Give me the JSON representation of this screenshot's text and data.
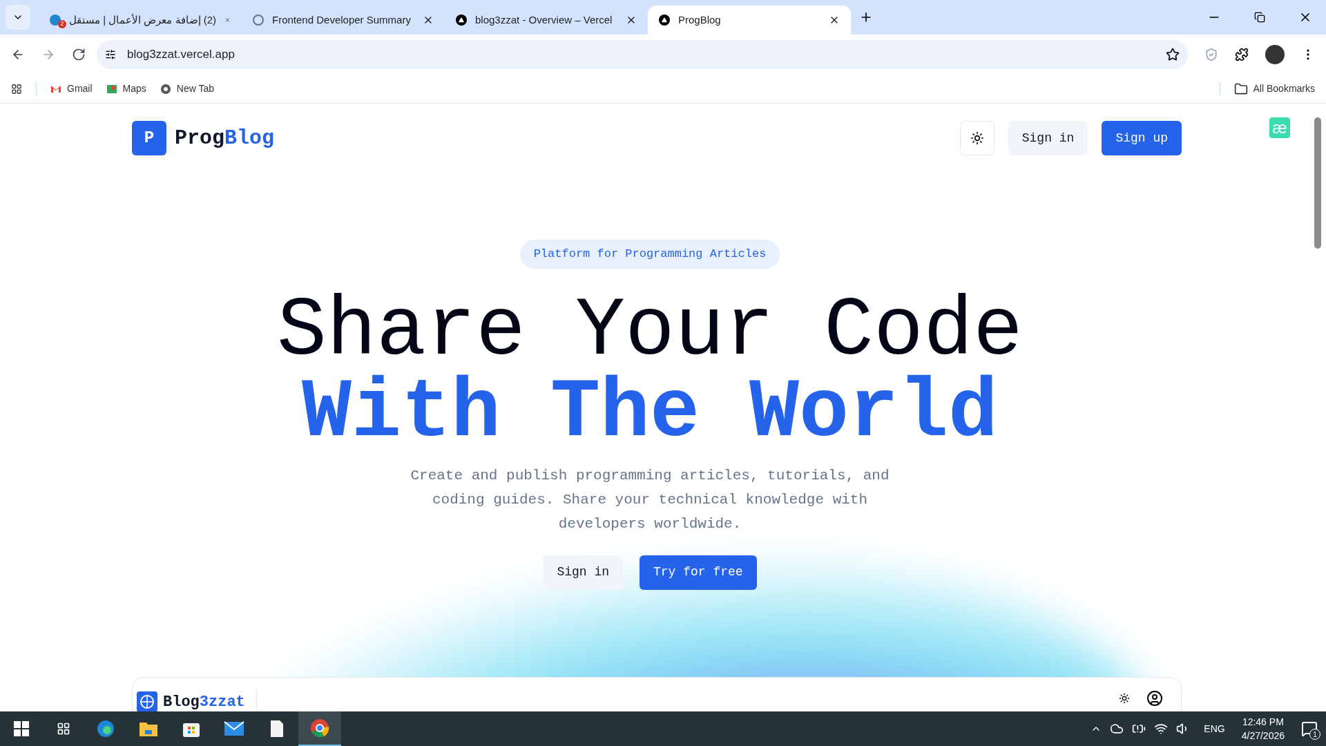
{
  "browser": {
    "tabs": [
      {
        "title": "(2) إضافة معرض الأعمال | مستقل",
        "badge": "2",
        "selected": false
      },
      {
        "title": "Frontend Developer Summary",
        "selected": false
      },
      {
        "title": "blog3zzat - Overview – Vercel",
        "selected": false
      },
      {
        "title": "ProgBlog",
        "selected": true
      }
    ],
    "url": "blog3zzat.vercel.app",
    "bookmarks": [
      {
        "label": "Gmail"
      },
      {
        "label": "Maps"
      },
      {
        "label": "New Tab"
      }
    ],
    "all_bookmarks": "All Bookmarks"
  },
  "page": {
    "logo": {
      "letter": "P",
      "name_part1": "Prog",
      "name_part2": "Blog"
    },
    "nav_buttons": [
      {
        "label": "Sign in",
        "kind": "secondary"
      },
      {
        "label": "Sign up",
        "kind": "primary"
      }
    ],
    "extension_badge": "æ",
    "badge": "Platform for Programming Articles",
    "headline_line1": "Share Your Code",
    "headline_line2": "With The World",
    "description": "Create and publish programming articles, tutorials, and coding guides. Share your technical knowledge with developers worldwide.",
    "cta_buttons": [
      {
        "label": "Sign in",
        "kind": "secondary"
      },
      {
        "label": "Try for free",
        "kind": "primary"
      }
    ],
    "preview": {
      "name_part1": "Blog",
      "name_part2": "3zzat"
    }
  },
  "taskbar": {
    "apps": [
      {
        "active": false
      },
      {
        "active": false
      },
      {
        "active": false
      },
      {
        "active": false
      },
      {
        "active": false
      },
      {
        "active": true
      }
    ],
    "language": "ENG",
    "time": "12:46 PM",
    "date": "4/27/2026",
    "notifications": "1"
  }
}
